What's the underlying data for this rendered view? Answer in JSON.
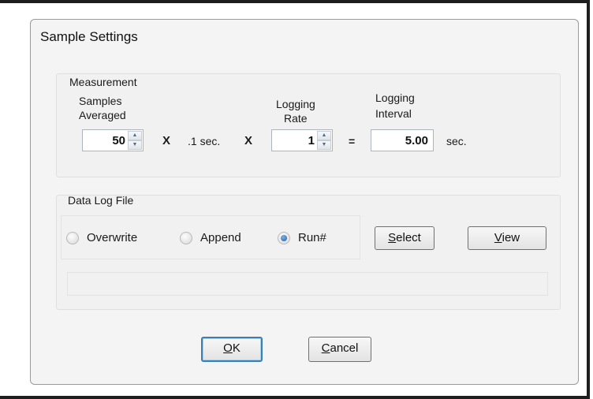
{
  "dialog": {
    "title": "Sample Settings"
  },
  "measurement": {
    "group_label": "Measurement",
    "samples_averaged_label_line1": "Samples",
    "samples_averaged_label_line2": "Averaged",
    "samples_averaged_value": "50",
    "times_sign_1": "X",
    "interval_text": ".1 sec.",
    "times_sign_2": "X",
    "logging_rate_label_line1": "Logging",
    "logging_rate_label_line2": "Rate",
    "logging_rate_value": "1",
    "equals_sign": "=",
    "logging_interval_label_line1": "Logging",
    "logging_interval_label_line2": "Interval",
    "logging_interval_value": "5.00",
    "logging_interval_unit": "sec."
  },
  "data_log": {
    "group_label": "Data Log File",
    "options": [
      {
        "label": "Overwrite",
        "checked": false
      },
      {
        "label": "Append",
        "checked": false
      },
      {
        "label": "Run#",
        "checked": true
      }
    ],
    "select_button": {
      "underlined": "S",
      "rest": "elect"
    },
    "view_button": {
      "underlined": "V",
      "rest": "iew"
    },
    "file_path": ""
  },
  "footer": {
    "ok_button": {
      "underlined": "O",
      "rest": "K"
    },
    "cancel_button": {
      "underlined": "C",
      "rest": "ancel"
    }
  },
  "icons": {
    "spin_up": "spin-up-arrow",
    "spin_down": "spin-down-arrow"
  }
}
